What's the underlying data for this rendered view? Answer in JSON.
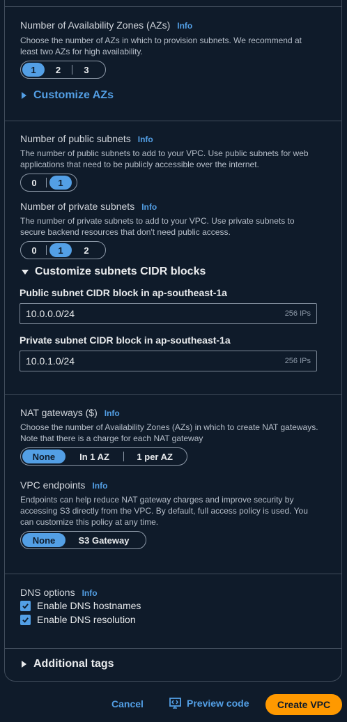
{
  "azs": {
    "label": "Number of Availability Zones (AZs)",
    "info": "Info",
    "description": "Choose the number of AZs in which to provision subnets. We recommend at least two AZs for high availability.",
    "options": [
      "1",
      "2",
      "3"
    ],
    "selected": "1",
    "customize": "Customize AZs"
  },
  "public_subnets": {
    "label": "Number of public subnets",
    "info": "Info",
    "description": "The number of public subnets to add to your VPC. Use public subnets for web applications that need to be publicly accessible over the internet.",
    "options": [
      "0",
      "1"
    ],
    "selected": "1"
  },
  "private_subnets": {
    "label": "Number of private subnets",
    "info": "Info",
    "description": "The number of private subnets to add to your VPC. Use private subnets to secure backend resources that don't need public access.",
    "options": [
      "0",
      "1",
      "2"
    ],
    "selected": "1"
  },
  "cidr": {
    "customize": "Customize subnets CIDR blocks",
    "public_label": "Public subnet CIDR block in ap-southeast-1a",
    "public_value": "10.0.0.0/24",
    "public_hint": "256 IPs",
    "private_label": "Private subnet CIDR block in ap-southeast-1a",
    "private_value": "10.0.1.0/24",
    "private_hint": "256 IPs"
  },
  "nat": {
    "label": "NAT gateways ($)",
    "info": "Info",
    "description": "Choose the number of Availability Zones (AZs) in which to create NAT gateways. Note that there is a charge for each NAT gateway",
    "options": [
      "None",
      "In 1 AZ",
      "1 per AZ"
    ],
    "selected": "None"
  },
  "endpoints": {
    "label": "VPC endpoints",
    "info": "Info",
    "description": "Endpoints can help reduce NAT gateway charges and improve security by accessing S3 directly from the VPC. By default, full access policy is used. You can customize this policy at any time.",
    "options": [
      "None",
      "S3 Gateway"
    ],
    "selected": "None"
  },
  "dns": {
    "label": "DNS options",
    "info": "Info",
    "hostnames": "Enable DNS hostnames",
    "resolution": "Enable DNS resolution"
  },
  "tags": {
    "label": "Additional tags"
  },
  "footer": {
    "cancel": "Cancel",
    "preview": "Preview code",
    "create": "Create VPC"
  },
  "colors": {
    "accent": "#539fe5",
    "primary": "#ff9900",
    "background": "#0f1b2a",
    "border": "#414d5c"
  }
}
